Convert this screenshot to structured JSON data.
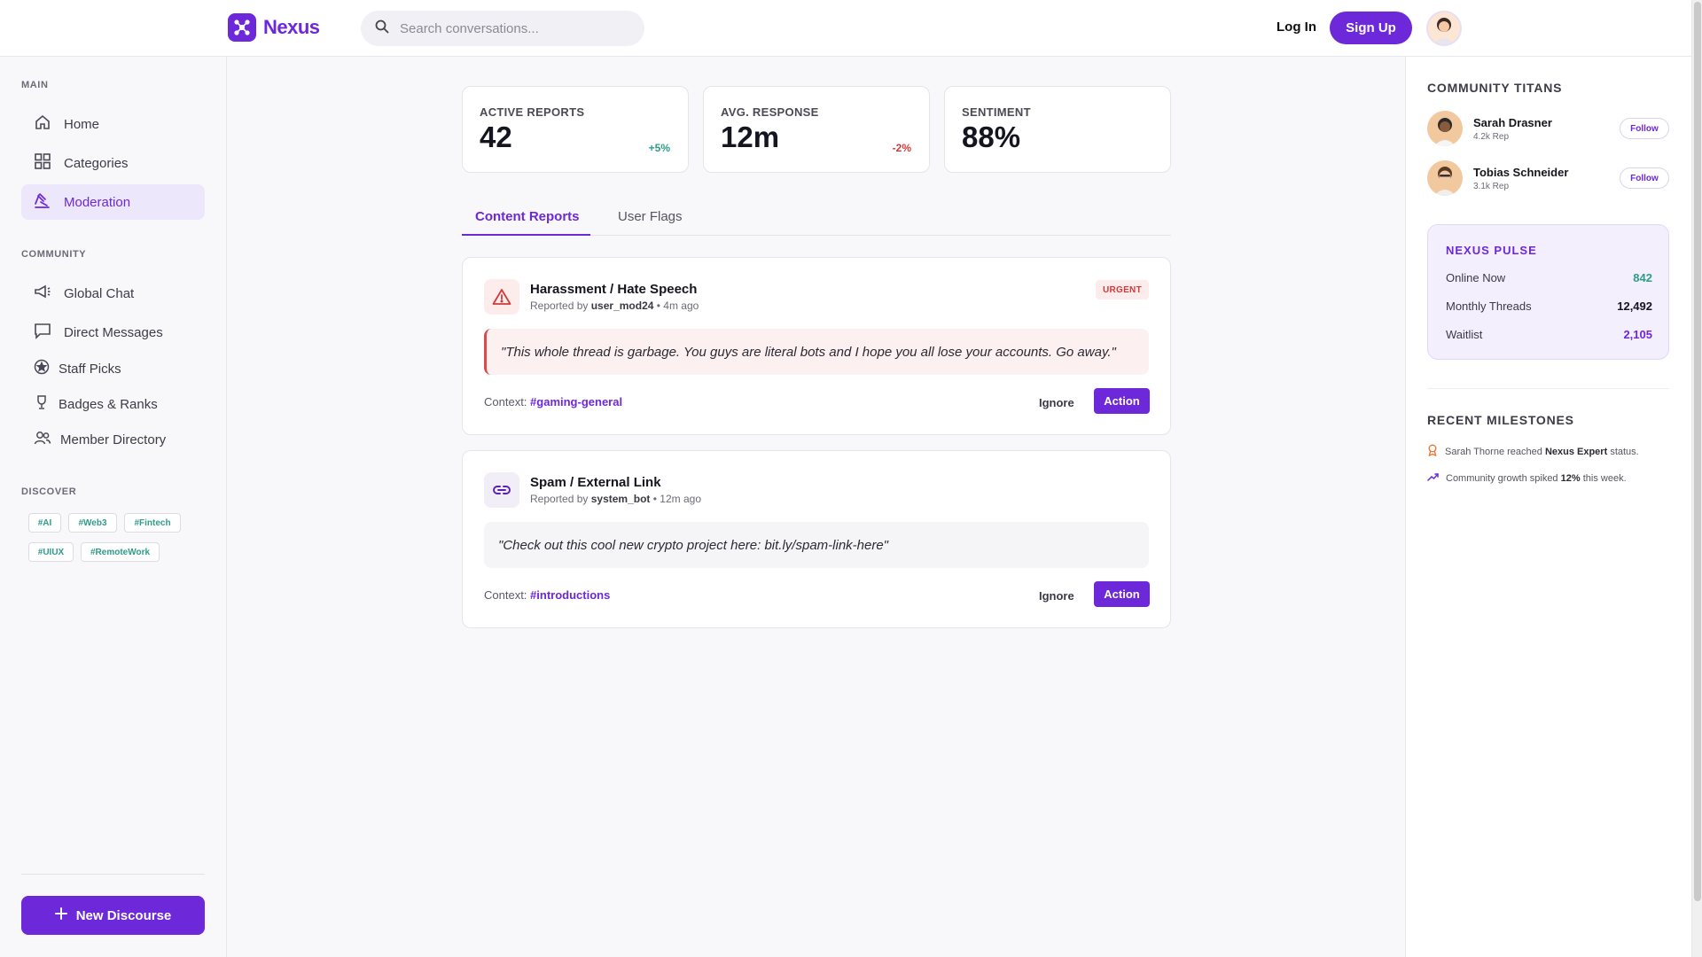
{
  "brand": {
    "name": "Nexus",
    "accent": "#6d28d9"
  },
  "search": {
    "placeholder": "Search conversations..."
  },
  "auth": {
    "login": "Log In",
    "signup": "Sign Up"
  },
  "sidebar": {
    "main_label": "MAIN",
    "main_items": [
      {
        "label": "Home",
        "icon": "home-icon"
      },
      {
        "label": "Categories",
        "icon": "grid-icon"
      },
      {
        "label": "Moderation",
        "icon": "gavel-icon",
        "active": true
      }
    ],
    "community_label": "COMMUNITY",
    "community_items": [
      {
        "label": "Global Chat",
        "icon": "megaphone-icon"
      },
      {
        "label": "Direct Messages",
        "icon": "message-icon"
      },
      {
        "label": "Staff Picks",
        "icon": "star-icon"
      },
      {
        "label": "Badges & Ranks",
        "icon": "trophy-icon"
      },
      {
        "label": "Member Directory",
        "icon": "users-icon"
      }
    ],
    "discover_label": "DISCOVER",
    "tags": [
      "#AI",
      "#Web3",
      "#Fintech",
      "#UIUX",
      "#RemoteWork"
    ],
    "new_button": "New Discourse"
  },
  "stats": [
    {
      "label": "ACTIVE REPORTS",
      "value": "42",
      "delta": "+5%",
      "delta_color": "#2f9c8a"
    },
    {
      "label": "AVG. RESPONSE",
      "value": "12m",
      "delta": "-2%",
      "delta_color": "#d23a3a"
    },
    {
      "label": "SENTIMENT",
      "value": "88%",
      "delta": ""
    }
  ],
  "tabs": [
    "Content Reports",
    "User Flags"
  ],
  "reports": [
    {
      "title": "Harassment / Hate Speech",
      "reported_prefix": "Reported by",
      "reporter": "user_mod24",
      "time": "• 4m ago",
      "badge": "URGENT",
      "quote": "\"This whole thread is garbage. You guys are literal bots and I hope you all lose your accounts. Go away.\"",
      "context_label": "Context:",
      "context": "#gaming-general",
      "ignore": "Ignore",
      "action": "Action"
    },
    {
      "title": "Spam / External Link",
      "reported_prefix": "Reported by",
      "reporter": "system_bot",
      "time": "• 12m ago",
      "quote": "\"Check out this cool new crypto project here: bit.ly/spam-link-here\"",
      "context_label": "Context:",
      "context": "#introductions",
      "ignore": "Ignore",
      "action": "Action"
    }
  ],
  "right": {
    "titans_title": "COMMUNITY TITANS",
    "titans": [
      {
        "name": "Sarah Drasner",
        "rep": "4.2k Rep",
        "follow": "Follow"
      },
      {
        "name": "Tobias Schneider",
        "rep": "3.1k Rep",
        "follow": "Follow"
      }
    ],
    "pulse_title": "NEXUS PULSE",
    "pulse": [
      {
        "label": "Online Now",
        "value": "842",
        "color": "#2f9c8a"
      },
      {
        "label": "Monthly Threads",
        "value": "12,492",
        "color": "#15151f"
      },
      {
        "label": "Waitlist",
        "value": "2,105",
        "color": "#6d28d9"
      }
    ],
    "milestones_title": "RECENT MILESTONES",
    "milestones": [
      {
        "pre": "Sarah Thorne reached",
        "bold": "Nexus Expert",
        "post": "status."
      },
      {
        "pre": "Community growth spiked",
        "bold": "12%",
        "post": "this week."
      }
    ]
  }
}
